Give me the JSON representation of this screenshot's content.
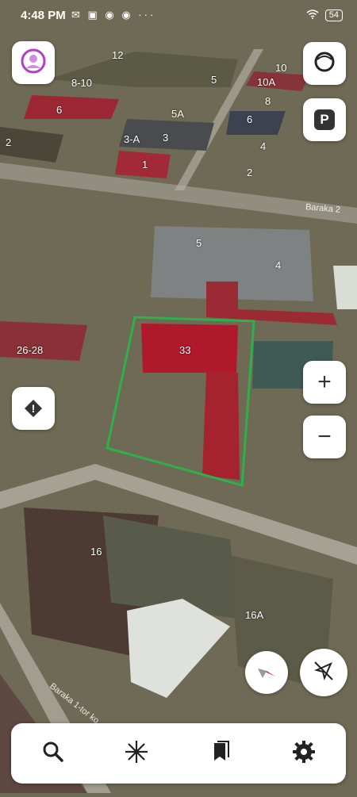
{
  "status_bar": {
    "time": "4:48 PM",
    "notification_icons": "✉ ▣ ◉ ◉ ···",
    "battery": "54"
  },
  "map": {
    "parcel_labels": [
      "12",
      "8-10",
      "5",
      "10",
      "10A",
      "6",
      "5A",
      "8",
      "6",
      "3-A",
      "3",
      "4",
      "2",
      "1",
      "2",
      "5",
      "4",
      "33",
      "26-28",
      "16",
      "16A"
    ],
    "street_labels": [
      "Baraka 2",
      "Baraka 1-tor ko"
    ]
  },
  "controls": {
    "zoom_in": "+",
    "zoom_out": "−",
    "parking_label": "P",
    "alert_label": "!"
  },
  "bottom_nav": {
    "search": "search-icon",
    "layers": "layers-icon",
    "bookmarks": "bookmarks-icon",
    "settings": "settings-icon"
  }
}
